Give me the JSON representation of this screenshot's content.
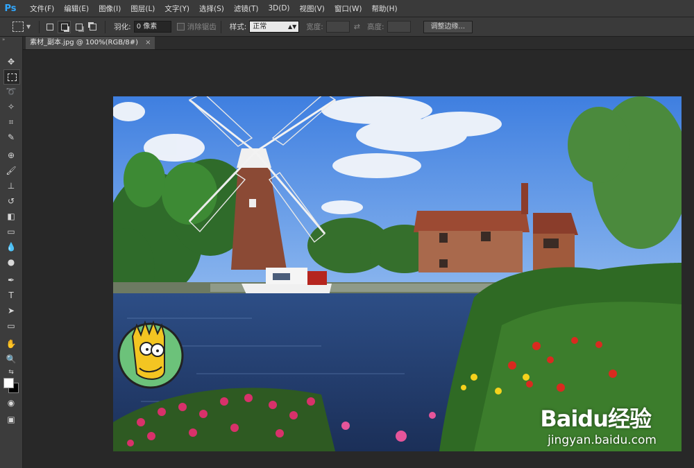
{
  "app": {
    "logo": "Ps"
  },
  "menu": [
    "文件(F)",
    "编辑(E)",
    "图像(I)",
    "图层(L)",
    "文字(Y)",
    "选择(S)",
    "滤镜(T)",
    "3D(D)",
    "视图(V)",
    "窗口(W)",
    "帮助(H)"
  ],
  "options": {
    "feather_label": "羽化:",
    "feather_value": "0 像素",
    "antialias_label": "消除锯齿",
    "style_label": "样式:",
    "style_value": "正常",
    "width_label": "宽度:",
    "height_label": "高度:",
    "refine_edge_label": "调整边缘..."
  },
  "document": {
    "tab_title": "素材_副本.jpg @ 100%(RGB/8#)",
    "close_glyph": "×"
  },
  "toolbar": {
    "handle": "»",
    "tools": [
      "move-tool",
      "rectangular-marquee-tool",
      "lasso-tool",
      "quick-selection-tool",
      "crop-tool",
      "eyedropper-tool",
      "spot-healing-brush-tool",
      "brush-tool",
      "clone-stamp-tool",
      "history-brush-tool",
      "eraser-tool",
      "gradient-tool",
      "blur-tool",
      "dodge-tool",
      "pen-tool",
      "type-tool",
      "path-selection-tool",
      "rectangle-tool",
      "hand-tool",
      "zoom-tool"
    ]
  },
  "watermark": {
    "logo": "Baidu经验",
    "url": "jingyan.baidu.com"
  },
  "colors": {
    "foreground": "#ffffff",
    "background": "#000000",
    "accent": "#31a8ff"
  }
}
